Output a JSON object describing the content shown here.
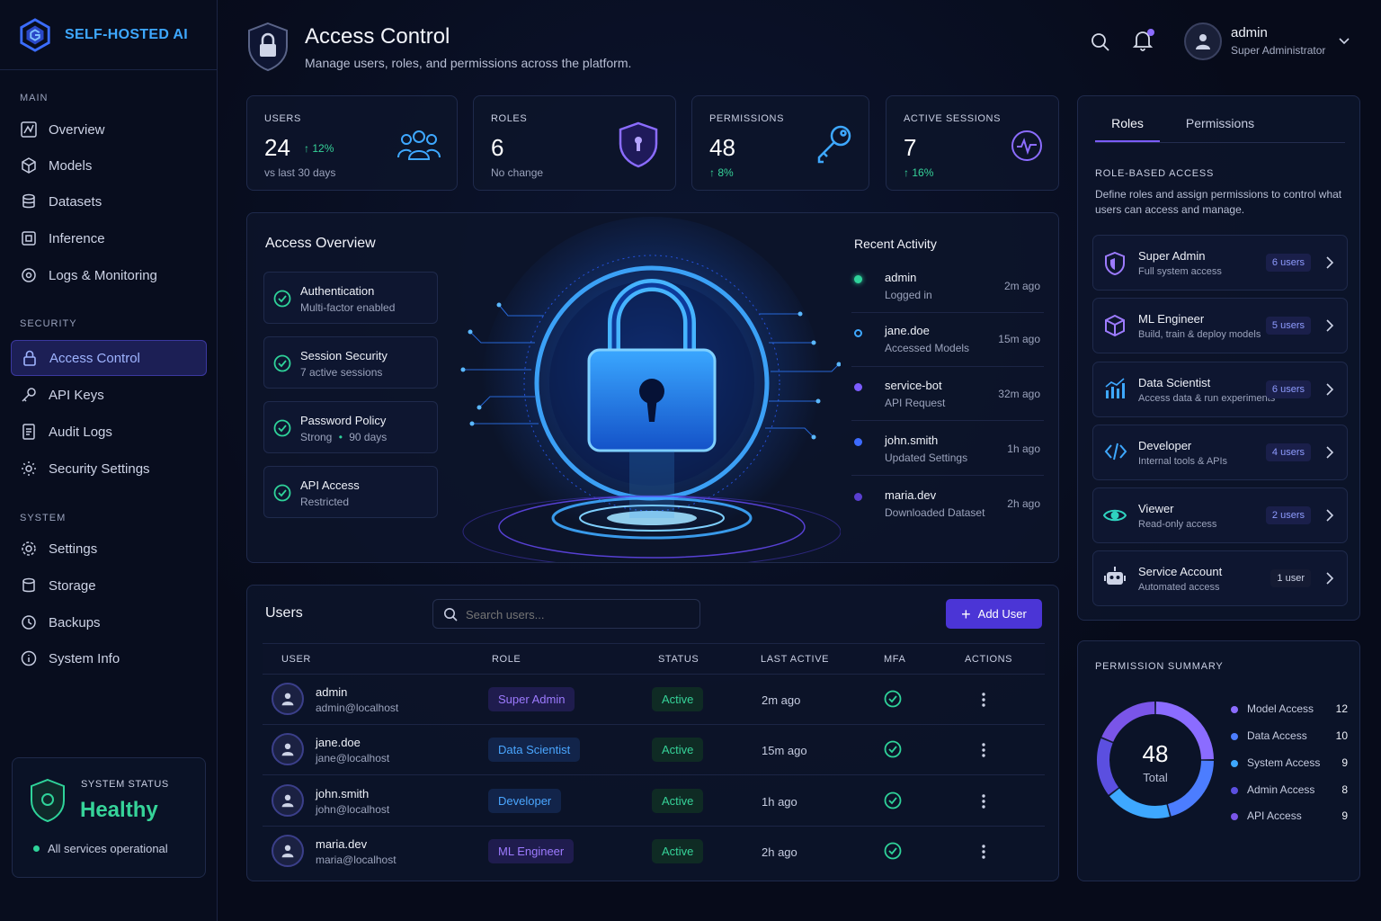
{
  "brand": {
    "name": "SELF-HOSTED AI",
    "accent": "#3ea8ff"
  },
  "sidebar": {
    "sections": [
      {
        "title": "MAIN"
      },
      {
        "title": "SECURITY"
      },
      {
        "title": "SYSTEM"
      }
    ],
    "items": [
      {
        "label": "Overview",
        "icon": "overview-icon"
      },
      {
        "label": "Models",
        "icon": "cube-icon"
      },
      {
        "label": "Datasets",
        "icon": "database-icon"
      },
      {
        "label": "Inference",
        "icon": "chip-icon"
      },
      {
        "label": "Logs & Monitoring",
        "icon": "monitor-icon"
      },
      {
        "label": "Access Control",
        "icon": "lock-icon",
        "active": true
      },
      {
        "label": "API Keys",
        "icon": "key-icon"
      },
      {
        "label": "Audit Logs",
        "icon": "document-icon"
      },
      {
        "label": "Security Settings",
        "icon": "shield-gear-icon"
      },
      {
        "label": "Settings",
        "icon": "gear-icon"
      },
      {
        "label": "Storage",
        "icon": "storage-icon"
      },
      {
        "label": "Backups",
        "icon": "backup-icon"
      },
      {
        "label": "System Info",
        "icon": "info-icon"
      }
    ],
    "status": {
      "label": "SYSTEM STATUS",
      "value": "Healthy",
      "note": "All services operational"
    }
  },
  "header": {
    "title": "Access Control",
    "subtitle": "Manage users, roles, and permissions across the platform.",
    "user": {
      "name": "admin",
      "role": "Super Administrator"
    }
  },
  "stats": [
    {
      "label": "USERS",
      "value": "24",
      "change": "12%",
      "note": "vs last 30 days",
      "icon": "users-icon"
    },
    {
      "label": "ROLES",
      "value": "6",
      "note": "No change",
      "icon": "shield-icon"
    },
    {
      "label": "PERMISSIONS",
      "value": "48",
      "change": "8%",
      "icon": "key-icon"
    },
    {
      "label": "ACTIVE SESSIONS",
      "value": "7",
      "change": "16%",
      "icon": "pulse-icon"
    }
  ],
  "overview": {
    "title": "Access Overview",
    "items": [
      {
        "title": "Authentication",
        "sub": "Multi-factor enabled"
      },
      {
        "title": "Session Security",
        "sub": "7 active sessions"
      },
      {
        "title": "Password Policy",
        "sub": "Strong",
        "sub2": "90 days"
      },
      {
        "title": "API Access",
        "sub": "Restricted"
      }
    ]
  },
  "activity": {
    "title": "Recent Activity",
    "items": [
      {
        "user": "admin",
        "action": "Logged in",
        "time": "2m ago",
        "color": "#2fd39a"
      },
      {
        "user": "jane.doe",
        "action": "Accessed Models",
        "time": "15m ago",
        "color": "#3ea8ff"
      },
      {
        "user": "service-bot",
        "action": "API Request",
        "time": "32m ago",
        "color": "#7c5cff"
      },
      {
        "user": "john.smith",
        "action": "Updated Settings",
        "time": "1h ago",
        "color": "#3d6bff"
      },
      {
        "user": "maria.dev",
        "action": "Downloaded Dataset",
        "time": "2h ago",
        "color": "#5a3fd0"
      }
    ]
  },
  "users": {
    "title": "Users",
    "search_placeholder": "Search users...",
    "add_label": "Add User",
    "columns": [
      "USER",
      "ROLE",
      "STATUS",
      "LAST ACTIVE",
      "MFA",
      "ACTIONS"
    ],
    "rows": [
      {
        "name": "admin",
        "email": "admin@localhost",
        "role": "Super Admin",
        "role_color": "#9d7bff",
        "status": "Active",
        "last": "2m ago"
      },
      {
        "name": "jane.doe",
        "email": "jane@localhost",
        "role": "Data Scientist",
        "role_color": "#4aa6ff",
        "status": "Active",
        "last": "15m ago"
      },
      {
        "name": "john.smith",
        "email": "john@localhost",
        "role": "Developer",
        "role_color": "#4aa6ff",
        "status": "Active",
        "last": "1h ago"
      },
      {
        "name": "maria.dev",
        "email": "maria@localhost",
        "role": "ML Engineer",
        "role_color": "#9d7bff",
        "status": "Active",
        "last": "2h ago"
      }
    ]
  },
  "roles_panel": {
    "tabs": [
      "Roles",
      "Permissions"
    ],
    "heading": "ROLE-BASED ACCESS",
    "description": "Define roles and assign permissions to control what users can access and manage.",
    "roles": [
      {
        "name": "Super Admin",
        "desc": "Full system access",
        "count": "6 users",
        "icon": "shield-icon"
      },
      {
        "name": "ML Engineer",
        "desc": "Build, train & deploy models",
        "count": "5 users",
        "icon": "cube-icon"
      },
      {
        "name": "Data Scientist",
        "desc": "Access data & run experiments",
        "count": "6 users",
        "icon": "bar-chart-icon"
      },
      {
        "name": "Developer",
        "desc": "Internal tools & APIs",
        "count": "4 users",
        "icon": "code-icon"
      },
      {
        "name": "Viewer",
        "desc": "Read-only access",
        "count": "2 users",
        "icon": "eye-icon"
      },
      {
        "name": "Service Account",
        "desc": "Automated access",
        "count": "1 user",
        "icon": "robot-icon"
      }
    ]
  },
  "permission_summary": {
    "title": "PERMISSION SUMMARY",
    "total": "48",
    "total_label": "Total",
    "items": [
      {
        "name": "Model Access",
        "value": 12,
        "color": "#8b6cff"
      },
      {
        "name": "Data Access",
        "value": 10,
        "color": "#4c7dff"
      },
      {
        "name": "System Access",
        "value": 9,
        "color": "#3ea8ff"
      },
      {
        "name": "Admin Access",
        "value": 8,
        "color": "#5b4fe0"
      },
      {
        "name": "API Access",
        "value": 9,
        "color": "#7a55e8"
      }
    ]
  }
}
